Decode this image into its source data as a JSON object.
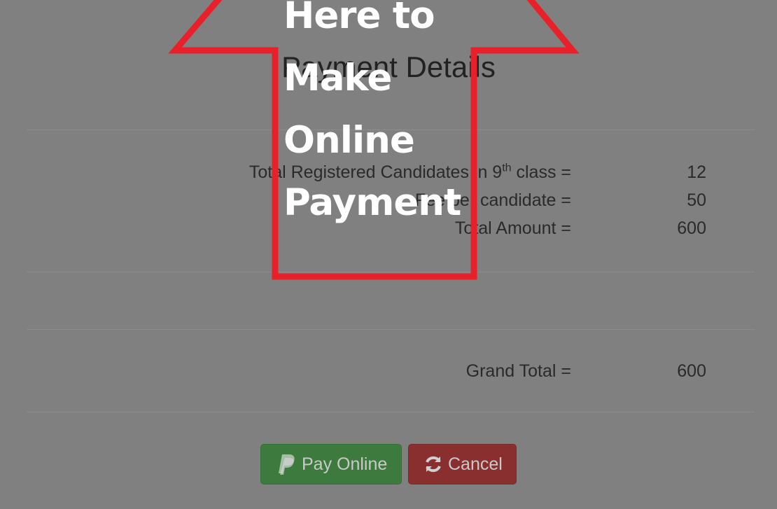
{
  "page": {
    "title": "Payment Details"
  },
  "summary": {
    "registered_label_prefix": "Total Registered Candidates in 9",
    "registered_label_sup": "th",
    "registered_label_suffix": " class =",
    "registered_value": "12",
    "per_candidate_label": "Fee per candidate =",
    "per_candidate_value": "50",
    "total_amount_label": "Total Amount =",
    "total_amount_value": "600"
  },
  "grand": {
    "label": "Grand Total =",
    "value": "600"
  },
  "actions": {
    "pay_online_label": "Pay Online",
    "cancel_label": "Cancel",
    "pay_icon": "paypal-icon",
    "cancel_icon": "refresh-icon"
  },
  "annotation": {
    "lines": [
      "Here to",
      "Make",
      "Online",
      "Payment"
    ],
    "arrow_color": "#e8202a"
  },
  "colors": {
    "pay_button": "#3d7a3d",
    "cancel_button": "#8a2f2f",
    "backdrop": "#808080"
  }
}
